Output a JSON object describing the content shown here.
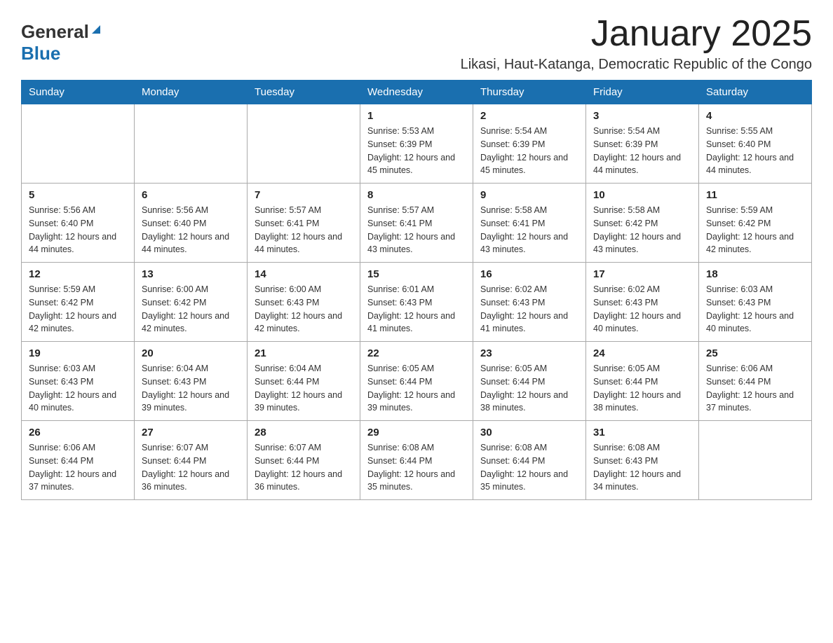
{
  "header": {
    "logo_general": "General",
    "logo_blue": "Blue",
    "month_title": "January 2025",
    "location": "Likasi, Haut-Katanga, Democratic Republic of the Congo"
  },
  "days_of_week": [
    "Sunday",
    "Monday",
    "Tuesday",
    "Wednesday",
    "Thursday",
    "Friday",
    "Saturday"
  ],
  "weeks": [
    [
      {
        "day": "",
        "sunrise": "",
        "sunset": "",
        "daylight": ""
      },
      {
        "day": "",
        "sunrise": "",
        "sunset": "",
        "daylight": ""
      },
      {
        "day": "",
        "sunrise": "",
        "sunset": "",
        "daylight": ""
      },
      {
        "day": "1",
        "sunrise": "Sunrise: 5:53 AM",
        "sunset": "Sunset: 6:39 PM",
        "daylight": "Daylight: 12 hours and 45 minutes."
      },
      {
        "day": "2",
        "sunrise": "Sunrise: 5:54 AM",
        "sunset": "Sunset: 6:39 PM",
        "daylight": "Daylight: 12 hours and 45 minutes."
      },
      {
        "day": "3",
        "sunrise": "Sunrise: 5:54 AM",
        "sunset": "Sunset: 6:39 PM",
        "daylight": "Daylight: 12 hours and 44 minutes."
      },
      {
        "day": "4",
        "sunrise": "Sunrise: 5:55 AM",
        "sunset": "Sunset: 6:40 PM",
        "daylight": "Daylight: 12 hours and 44 minutes."
      }
    ],
    [
      {
        "day": "5",
        "sunrise": "Sunrise: 5:56 AM",
        "sunset": "Sunset: 6:40 PM",
        "daylight": "Daylight: 12 hours and 44 minutes."
      },
      {
        "day": "6",
        "sunrise": "Sunrise: 5:56 AM",
        "sunset": "Sunset: 6:40 PM",
        "daylight": "Daylight: 12 hours and 44 minutes."
      },
      {
        "day": "7",
        "sunrise": "Sunrise: 5:57 AM",
        "sunset": "Sunset: 6:41 PM",
        "daylight": "Daylight: 12 hours and 44 minutes."
      },
      {
        "day": "8",
        "sunrise": "Sunrise: 5:57 AM",
        "sunset": "Sunset: 6:41 PM",
        "daylight": "Daylight: 12 hours and 43 minutes."
      },
      {
        "day": "9",
        "sunrise": "Sunrise: 5:58 AM",
        "sunset": "Sunset: 6:41 PM",
        "daylight": "Daylight: 12 hours and 43 minutes."
      },
      {
        "day": "10",
        "sunrise": "Sunrise: 5:58 AM",
        "sunset": "Sunset: 6:42 PM",
        "daylight": "Daylight: 12 hours and 43 minutes."
      },
      {
        "day": "11",
        "sunrise": "Sunrise: 5:59 AM",
        "sunset": "Sunset: 6:42 PM",
        "daylight": "Daylight: 12 hours and 42 minutes."
      }
    ],
    [
      {
        "day": "12",
        "sunrise": "Sunrise: 5:59 AM",
        "sunset": "Sunset: 6:42 PM",
        "daylight": "Daylight: 12 hours and 42 minutes."
      },
      {
        "day": "13",
        "sunrise": "Sunrise: 6:00 AM",
        "sunset": "Sunset: 6:42 PM",
        "daylight": "Daylight: 12 hours and 42 minutes."
      },
      {
        "day": "14",
        "sunrise": "Sunrise: 6:00 AM",
        "sunset": "Sunset: 6:43 PM",
        "daylight": "Daylight: 12 hours and 42 minutes."
      },
      {
        "day": "15",
        "sunrise": "Sunrise: 6:01 AM",
        "sunset": "Sunset: 6:43 PM",
        "daylight": "Daylight: 12 hours and 41 minutes."
      },
      {
        "day": "16",
        "sunrise": "Sunrise: 6:02 AM",
        "sunset": "Sunset: 6:43 PM",
        "daylight": "Daylight: 12 hours and 41 minutes."
      },
      {
        "day": "17",
        "sunrise": "Sunrise: 6:02 AM",
        "sunset": "Sunset: 6:43 PM",
        "daylight": "Daylight: 12 hours and 40 minutes."
      },
      {
        "day": "18",
        "sunrise": "Sunrise: 6:03 AM",
        "sunset": "Sunset: 6:43 PM",
        "daylight": "Daylight: 12 hours and 40 minutes."
      }
    ],
    [
      {
        "day": "19",
        "sunrise": "Sunrise: 6:03 AM",
        "sunset": "Sunset: 6:43 PM",
        "daylight": "Daylight: 12 hours and 40 minutes."
      },
      {
        "day": "20",
        "sunrise": "Sunrise: 6:04 AM",
        "sunset": "Sunset: 6:43 PM",
        "daylight": "Daylight: 12 hours and 39 minutes."
      },
      {
        "day": "21",
        "sunrise": "Sunrise: 6:04 AM",
        "sunset": "Sunset: 6:44 PM",
        "daylight": "Daylight: 12 hours and 39 minutes."
      },
      {
        "day": "22",
        "sunrise": "Sunrise: 6:05 AM",
        "sunset": "Sunset: 6:44 PM",
        "daylight": "Daylight: 12 hours and 39 minutes."
      },
      {
        "day": "23",
        "sunrise": "Sunrise: 6:05 AM",
        "sunset": "Sunset: 6:44 PM",
        "daylight": "Daylight: 12 hours and 38 minutes."
      },
      {
        "day": "24",
        "sunrise": "Sunrise: 6:05 AM",
        "sunset": "Sunset: 6:44 PM",
        "daylight": "Daylight: 12 hours and 38 minutes."
      },
      {
        "day": "25",
        "sunrise": "Sunrise: 6:06 AM",
        "sunset": "Sunset: 6:44 PM",
        "daylight": "Daylight: 12 hours and 37 minutes."
      }
    ],
    [
      {
        "day": "26",
        "sunrise": "Sunrise: 6:06 AM",
        "sunset": "Sunset: 6:44 PM",
        "daylight": "Daylight: 12 hours and 37 minutes."
      },
      {
        "day": "27",
        "sunrise": "Sunrise: 6:07 AM",
        "sunset": "Sunset: 6:44 PM",
        "daylight": "Daylight: 12 hours and 36 minutes."
      },
      {
        "day": "28",
        "sunrise": "Sunrise: 6:07 AM",
        "sunset": "Sunset: 6:44 PM",
        "daylight": "Daylight: 12 hours and 36 minutes."
      },
      {
        "day": "29",
        "sunrise": "Sunrise: 6:08 AM",
        "sunset": "Sunset: 6:44 PM",
        "daylight": "Daylight: 12 hours and 35 minutes."
      },
      {
        "day": "30",
        "sunrise": "Sunrise: 6:08 AM",
        "sunset": "Sunset: 6:44 PM",
        "daylight": "Daylight: 12 hours and 35 minutes."
      },
      {
        "day": "31",
        "sunrise": "Sunrise: 6:08 AM",
        "sunset": "Sunset: 6:43 PM",
        "daylight": "Daylight: 12 hours and 34 minutes."
      },
      {
        "day": "",
        "sunrise": "",
        "sunset": "",
        "daylight": ""
      }
    ]
  ]
}
